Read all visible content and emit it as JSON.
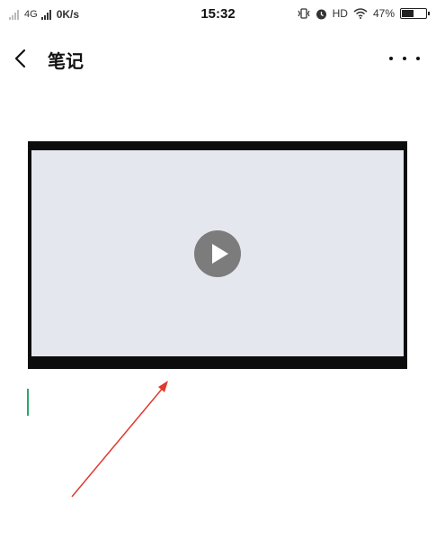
{
  "status_bar": {
    "network_type": "4G",
    "speed": "0K/s",
    "time": "15:32",
    "hd_label": "HD",
    "battery_percent": "47%",
    "battery_level": 0.47
  },
  "header": {
    "back_icon": "chevron-left-icon",
    "title": "笔记",
    "more_icon": "more-dots-icon"
  },
  "content": {
    "video_play_icon": "play-icon"
  },
  "colors": {
    "caret": "#2aa86b",
    "annotation_arrow": "#e03a2e",
    "video_placeholder": "#e5e7ee",
    "play_button": "#7c7c7c"
  }
}
